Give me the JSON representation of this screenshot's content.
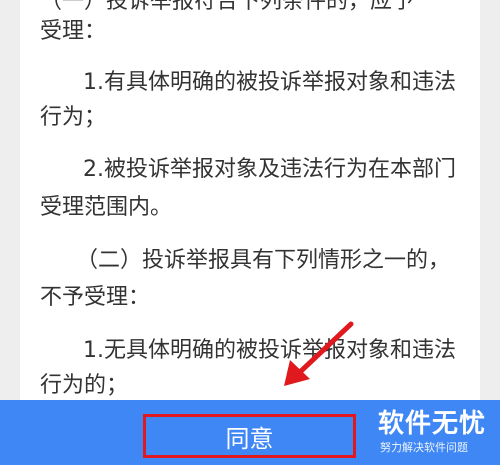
{
  "content": {
    "lines": [
      "（一）投诉举报符合下列条件的，应予",
      "受理：",
      "1.有具体明确的被投诉举报对象和违法",
      "行为；",
      "2.被投诉举报对象及违法行为在本部门",
      "受理范围内。",
      "（二）投诉举报具有下列情形之一的，",
      "不予受理：",
      "1.无具体明确的被投诉举报对象和违法",
      "行为的；"
    ]
  },
  "footer": {
    "agree_label": "同意"
  },
  "watermark": {
    "title": "软件无忧",
    "subtitle": "努力解决软件问题"
  },
  "colors": {
    "bottom_bar": "#3f87f5",
    "highlight_box": "#e0191f",
    "arrow": "#e0191f",
    "text": "#333333"
  }
}
